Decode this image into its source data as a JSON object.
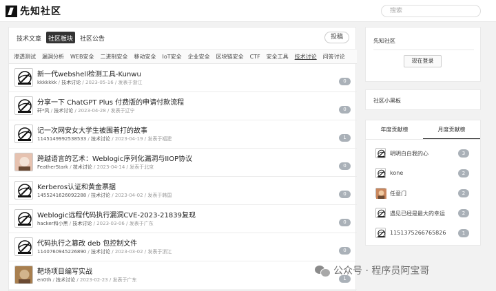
{
  "header": {
    "logo_text": "先知社区",
    "search_placeholder": "搜索"
  },
  "main": {
    "tabs": [
      {
        "label": "技术文章",
        "active": false
      },
      {
        "label": "社区板块",
        "active": true
      },
      {
        "label": "社区公告",
        "active": false
      }
    ],
    "post_button": "投稿",
    "categories": [
      "渗透测试",
      "漏洞分析",
      "WEB安全",
      "二进制安全",
      "移动安全",
      "IoT安全",
      "企业安全",
      "区块链安全",
      "CTF",
      "安全工具",
      "技术讨论",
      "问答讨论"
    ],
    "posts": [
      {
        "title": "新一代webshell检测工具-Kunwu",
        "author": "kkkkkkk",
        "category": "技术讨论",
        "date": "2023-05-16",
        "location": "发表于浙江",
        "count": "0",
        "avatar": "helmet"
      },
      {
        "title": "分享一下 ChatGPT Plus 付费版的申请付款流程",
        "author": "矸*风",
        "category": "技术讨论",
        "date": "2023-04-28",
        "location": "发表于辽宁",
        "count": "0",
        "avatar": "helmet"
      },
      {
        "title": "记一次网安女大学生被围着打的故事",
        "author": "1145149992538533",
        "category": "技术讨论",
        "date": "2023-04-19",
        "location": "发表于福建",
        "count": "1",
        "avatar": "helmet"
      },
      {
        "title": "跨越语言的艺术：Weblogic序列化漏洞与IIOP协议",
        "author": "FeatherStark",
        "category": "技术讨论",
        "date": "2023-04-14",
        "location": "发表于北京",
        "count": "0",
        "avatar": "photo"
      },
      {
        "title": "Kerberos认证和黄金票据",
        "author": "1455241626092288",
        "category": "技术讨论",
        "date": "2023-04-02",
        "location": "发表于韩国",
        "count": "0",
        "avatar": "helmet"
      },
      {
        "title": "Weblogic远程代码执行漏洞CVE-2023-21839复现",
        "author": "hacker和小黑",
        "category": "技术讨论",
        "date": "2023-03-06",
        "location": "发表于广东",
        "count": "0",
        "avatar": "helmet"
      },
      {
        "title": "代码执行之篡改 deb 包控制文件",
        "author": "1140760945226890",
        "category": "技术讨论",
        "date": "2023-03-02",
        "location": "发表于浙江",
        "count": "0",
        "avatar": "helmet"
      },
      {
        "title": "靶场项目编写实战",
        "author": "en0th",
        "category": "技术讨论",
        "date": "2023-02-23",
        "location": "发表于广东",
        "count": "1",
        "avatar": "photo2"
      }
    ]
  },
  "sidebar": {
    "community_title": "先知社区",
    "login_button": "现在登录",
    "blackroom": "社区小黑板",
    "rank_tabs": [
      "年度贡献榜",
      "月度贡献榜"
    ],
    "rank_active": 1,
    "rank": [
      {
        "name": "明明白白我的心",
        "count": "3",
        "avatar": "helmet"
      },
      {
        "name": "kone",
        "count": "2",
        "avatar": "helmet"
      },
      {
        "name": "任意门",
        "count": "2",
        "avatar": "photo"
      },
      {
        "name": "遇见已经是最大的幸运",
        "count": "2",
        "avatar": "helmet"
      },
      {
        "name": "1151375266765826",
        "count": "1",
        "avatar": "helmet"
      }
    ]
  },
  "watermark": {
    "text": "公众号 · 程序员阿宝哥"
  }
}
